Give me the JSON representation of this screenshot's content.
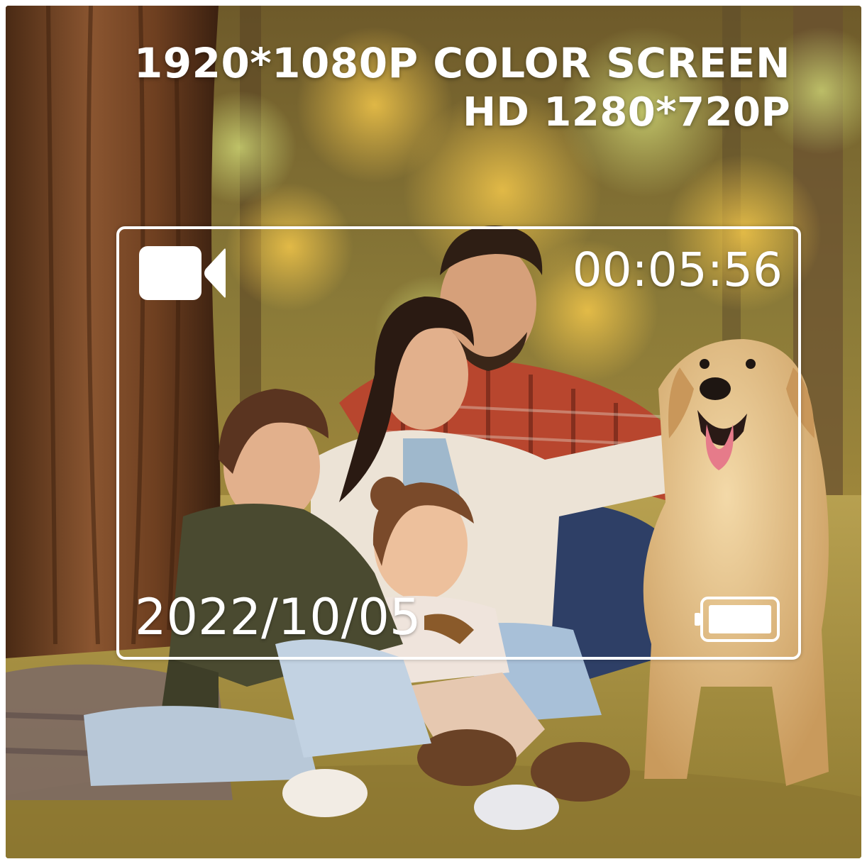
{
  "headline": {
    "line1": "1920*1080P COLOR SCREEN",
    "line2": "HD 1280*720P"
  },
  "viewfinder": {
    "timer": "00:05:56",
    "date": "2022/10/05",
    "mode_icon": "video-camera-icon",
    "battery_icon": "battery-icon",
    "battery_level": 1.0
  },
  "colors": {
    "overlay_text": "#ffffff",
    "frame_border": "#ffffff"
  }
}
